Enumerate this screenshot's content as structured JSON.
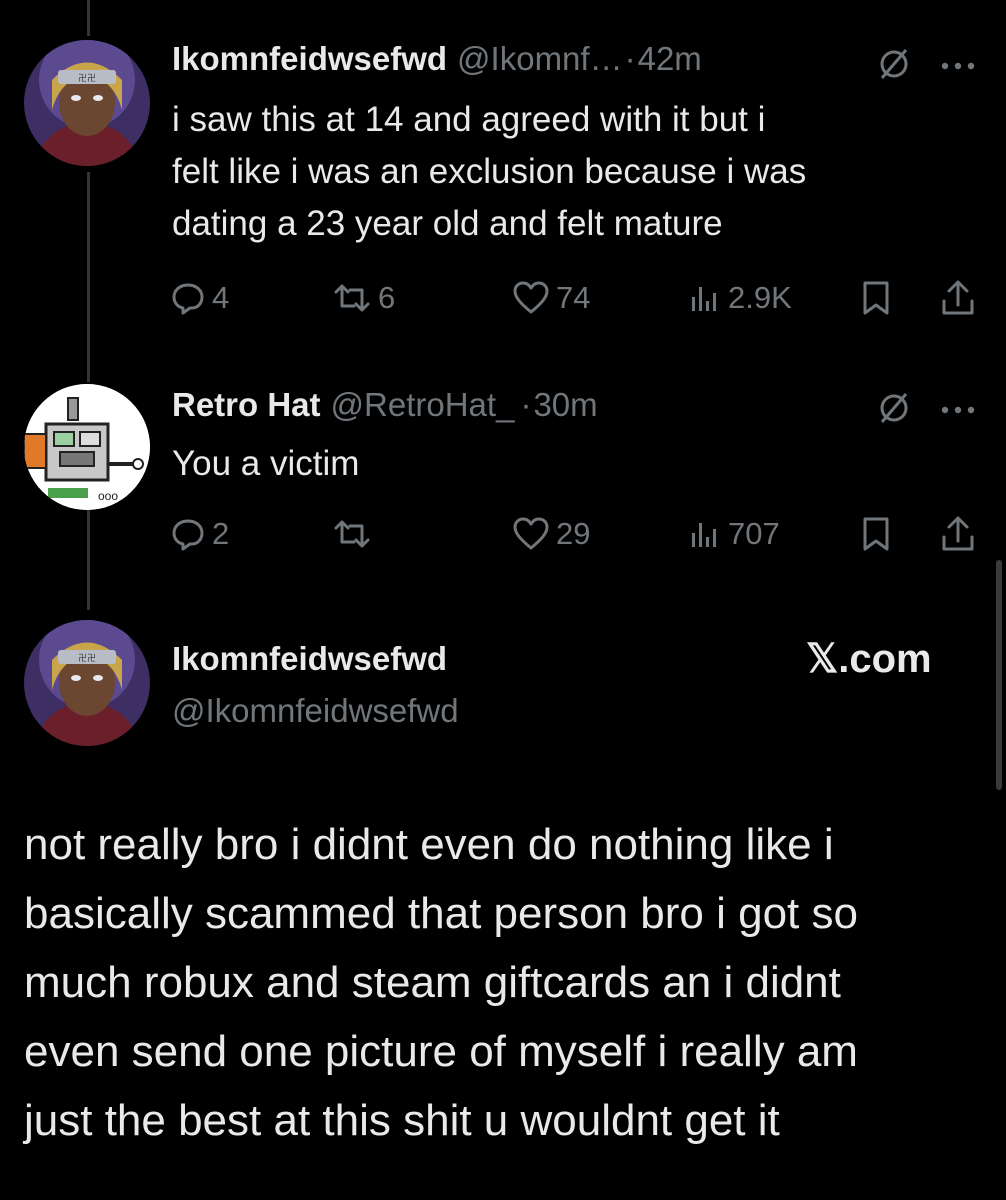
{
  "tweets": [
    {
      "name": "Ikomnfeidwsefwd",
      "handle": "@Ikomnf…",
      "dot": "·",
      "time": "42m",
      "text_lines": [
        "i saw this at 14 and agreed with it but i",
        "felt like i was an exclusion because i was",
        "dating a 23 year old and felt mature"
      ],
      "replies": "4",
      "reposts": "6",
      "likes": "74",
      "views": "2.9K"
    },
    {
      "name": "Retro Hat",
      "handle": "@RetroHat_",
      "dot": "·",
      "time": "30m",
      "text_lines": [
        "You a victim"
      ],
      "replies": "2",
      "reposts": "",
      "likes": "29",
      "views": "707"
    }
  ],
  "card": {
    "name": "Ikomnfeidwsefwd",
    "handle": "@Ikomnfeidwsefwd",
    "brand": "𝕏.com",
    "text_lines": [
      "not really bro i didnt even do nothing like i",
      "basically scammed that person bro i got so",
      "much robux and steam giftcards an i didnt",
      "even send one picture of myself i really am",
      "just the best at this shit u wouldnt get it"
    ]
  },
  "icons": {
    "reply": "reply-icon",
    "repost": "repost-icon",
    "like": "heart-icon",
    "views": "views-icon",
    "bookmark": "bookmark-icon",
    "share": "share-icon",
    "mute": "mute-icon",
    "more": "more-icon"
  },
  "colors": {
    "background": "#000000",
    "text": "#e7e9ea",
    "muted": "#71767b",
    "line": "#333639"
  }
}
